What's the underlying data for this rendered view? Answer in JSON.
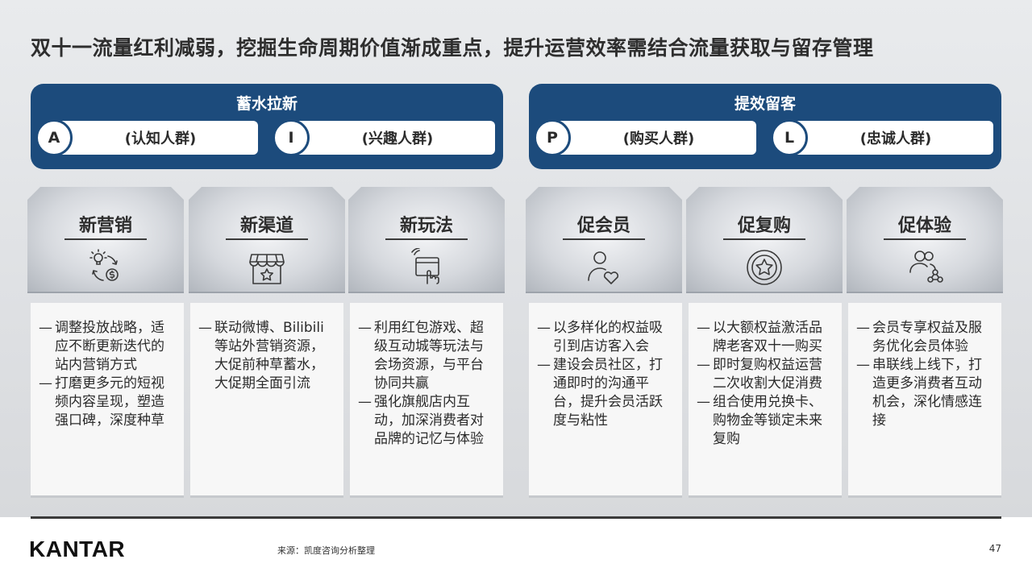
{
  "title": "双十一流量红利减弱，挖掘生命周期价值渐成重点，提升运营效率需结合流量获取与留存管理",
  "groups": [
    {
      "title": "蓄水拉新",
      "pills": [
        {
          "badge": "A",
          "label": "(认知人群)"
        },
        {
          "badge": "I",
          "label": "(兴趣人群)"
        }
      ]
    },
    {
      "title": "提效留客",
      "pills": [
        {
          "badge": "P",
          "label": "(购买人群)"
        },
        {
          "badge": "L",
          "label": "(忠诚人群)"
        }
      ]
    }
  ],
  "cards": [
    {
      "name": "新营销",
      "icon": "lightbulb-money-cycle-icon",
      "bullets": [
        "调整投放战略，适应不断更新迭代的站内营销方式",
        "打磨更多元的短视频内容呈现，塑造强口碑，深度种草"
      ]
    },
    {
      "name": "新渠道",
      "icon": "storefront-icon",
      "bullets": [
        "联动微博、Bilibili等站外营销资源，大促前种草蓄水，大促期全面引流"
      ]
    },
    {
      "name": "新玩法",
      "icon": "touch-screen-icon",
      "bullets": [
        "利用红包游戏、超级互动城等玩法与会场资源，与平台协同共赢",
        "强化旗舰店内互动，加深消费者对品牌的记忆与体验"
      ]
    },
    {
      "name": "促会员",
      "icon": "user-heart-icon",
      "bullets": [
        "以多样化的权益吸引到店访客入会",
        "建设会员社区，打通即时的沟通平台，提升会员活跃度与粘性"
      ]
    },
    {
      "name": "促复购",
      "icon": "star-badge-icon",
      "bullets": [
        "以大额权益激活品牌老客双十一购买",
        "即时复购权益运营二次收割大促消费",
        "组合使用兑换卡、购物金等锁定未来复购"
      ]
    },
    {
      "name": "促体验",
      "icon": "users-network-icon",
      "bullets": [
        "会员专享权益及服务优化会员体验",
        "串联线上线下，打造更多消费者互动机会，深化情感连接"
      ]
    }
  ],
  "footer": {
    "logo": "KANTAR",
    "source": "来源：凯度咨询分析整理",
    "page": "47"
  },
  "colors": {
    "header_blue": "#1c4b7c",
    "background_gray": "#e4e6e8",
    "text_dark": "#2b2b2b"
  }
}
